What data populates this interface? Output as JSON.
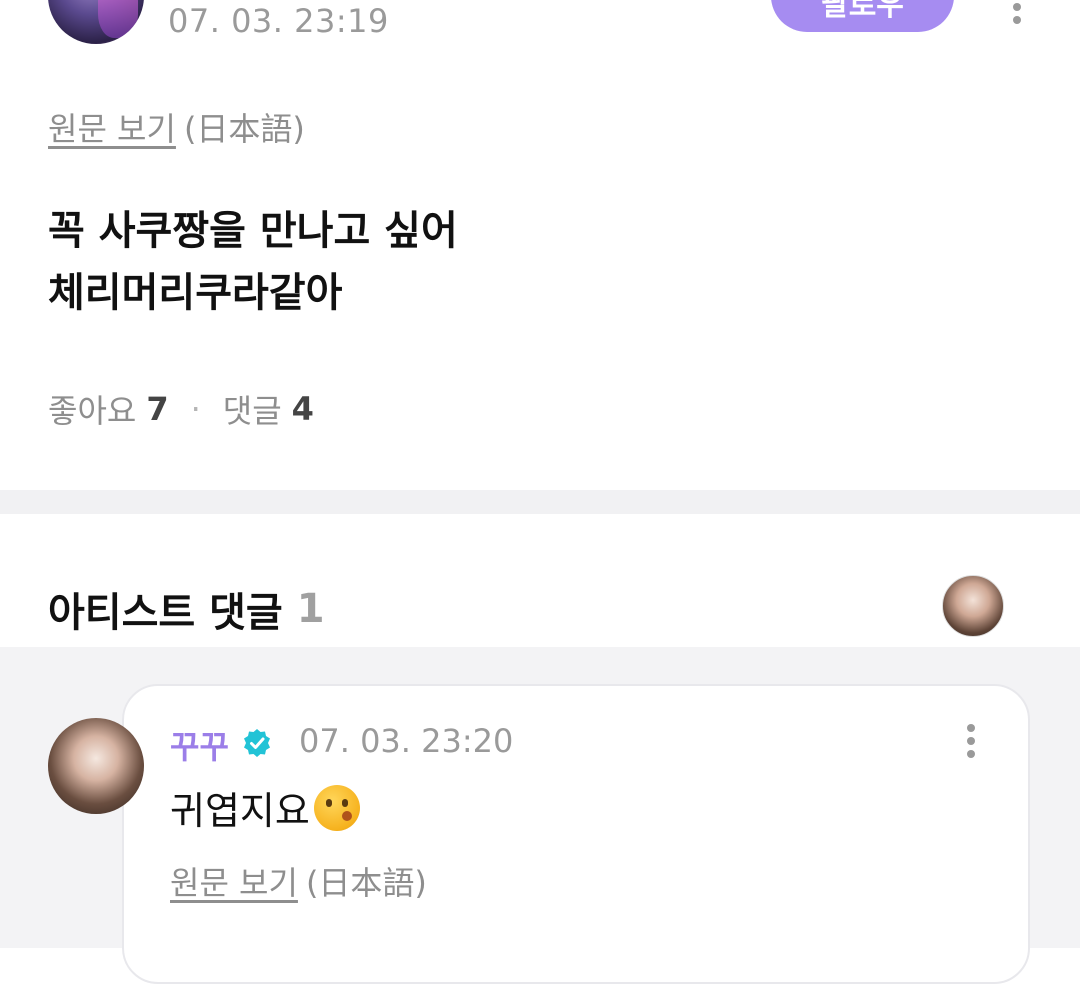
{
  "post": {
    "date": "07. 03. 23:19",
    "follow_label": "팔로우",
    "original_link": "원문 보기",
    "original_lang": "(日本語)",
    "body_lines": [
      "꼭 사쿠짱을 만나고 싶어",
      "체리머리쿠라같아"
    ],
    "likes_label": "좋아요",
    "likes_count": "7",
    "separator": "·",
    "comments_label": "댓글",
    "comments_count": "4"
  },
  "artist_comments": {
    "title": "아티스트 댓글",
    "count": "1"
  },
  "comment": {
    "author": "꾸꾸",
    "date": "07. 03. 23:20",
    "text": "귀엽지요",
    "emoji": "kissing-face-icon",
    "original_link": "원문 보기",
    "original_lang": "(日本語)"
  },
  "colors": {
    "accent": "#a68cf1",
    "author_name": "#9b7ee8",
    "verified_badge": "#22c3d6",
    "muted_text": "#8e8e8e",
    "divider": "#f1f1f3"
  }
}
